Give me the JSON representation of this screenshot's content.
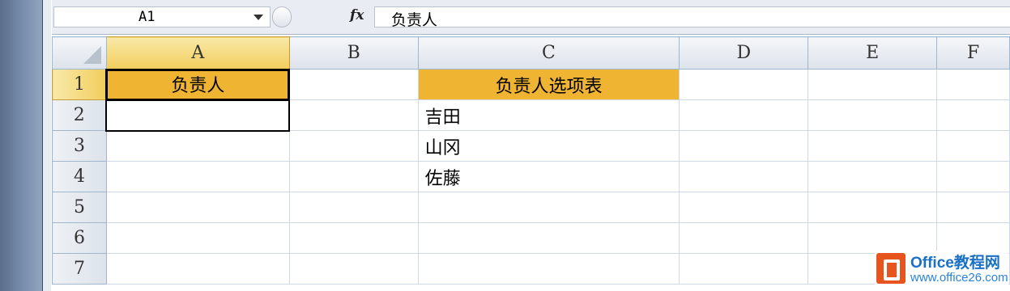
{
  "formula_bar": {
    "name_box": "A1",
    "fx_label": "fx",
    "formula": "负责人"
  },
  "columns": [
    "A",
    "B",
    "C",
    "D",
    "E",
    "F"
  ],
  "rows": [
    "1",
    "2",
    "3",
    "4",
    "5",
    "6",
    "7"
  ],
  "cells": {
    "A1": "负责人",
    "C1": "负责人选项表",
    "C2": "吉田",
    "C3": "山冈",
    "C4": "佐藤"
  },
  "colors": {
    "header_fill": "#efb431",
    "selection_header": "#f1cd5c"
  },
  "watermark": {
    "title": "Office教程网",
    "url": "www.office26.com"
  }
}
